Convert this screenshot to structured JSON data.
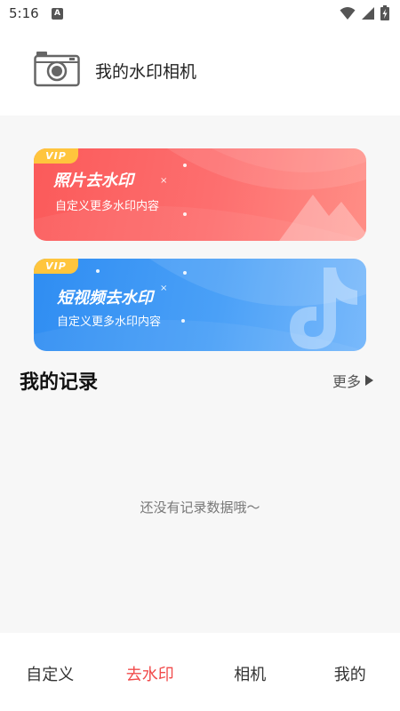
{
  "status_bar": {
    "time": "5:16",
    "notification_icon_letter": "A",
    "icons": [
      "wifi-icon",
      "signal-icon",
      "battery-charging-icon"
    ]
  },
  "header": {
    "title": "我的水印相机",
    "icon": "camera-icon"
  },
  "banners": [
    {
      "badge": "VIP",
      "title": "照片去水印",
      "subtitle": "自定义更多水印内容",
      "color": "#fb5a5a",
      "icon": "mountain-icon"
    },
    {
      "badge": "VIP",
      "title": "短视频去水印",
      "subtitle": "自定义更多水印内容",
      "color": "#3a94f4",
      "icon": "tiktok-note-icon"
    }
  ],
  "records": {
    "title": "我的记录",
    "more_label": "更多",
    "empty_text": "还没有记录数据哦～"
  },
  "tabs": [
    {
      "label": "自定义",
      "active": false
    },
    {
      "label": "去水印",
      "active": true
    },
    {
      "label": "相机",
      "active": false
    },
    {
      "label": "我的",
      "active": false
    }
  ],
  "colors": {
    "accent": "#f14b4b",
    "vip_badge": "#ffc53d",
    "background": "#f7f7f7"
  }
}
